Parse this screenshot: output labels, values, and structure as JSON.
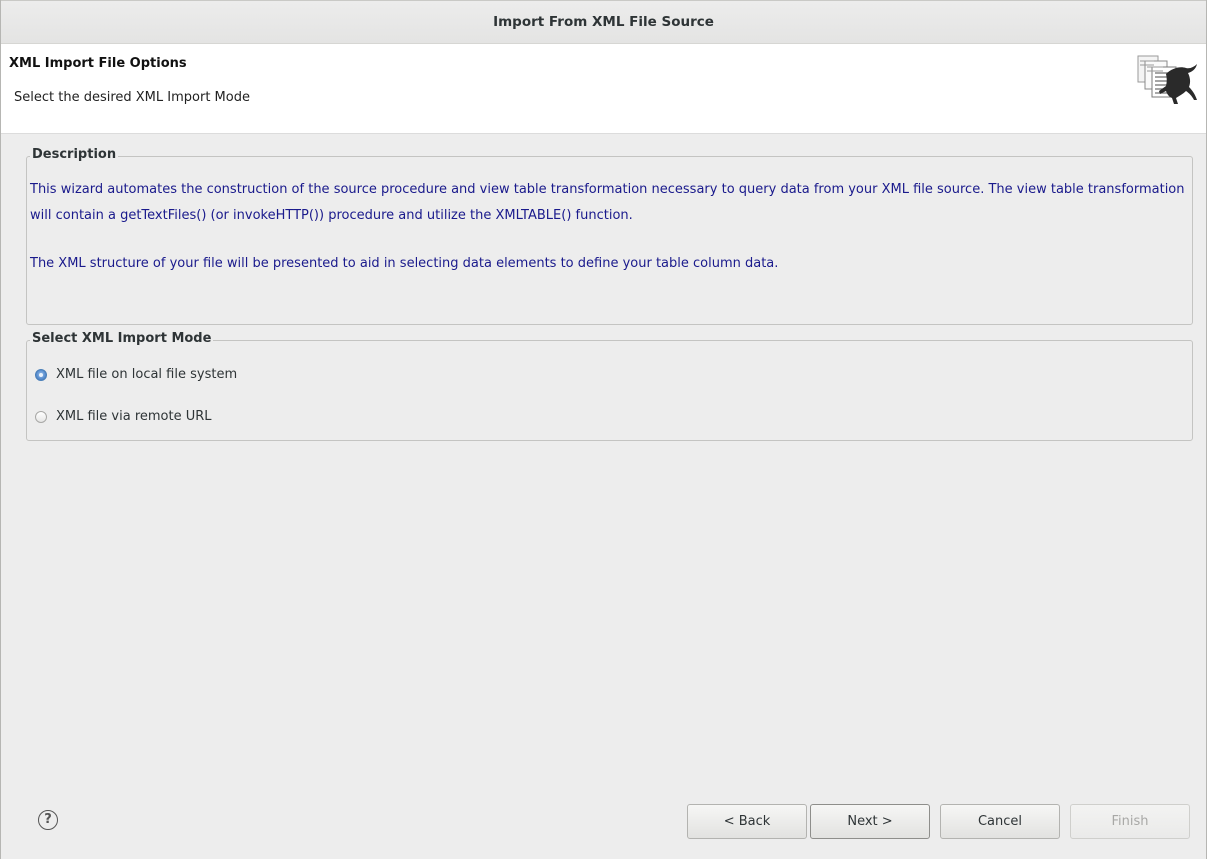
{
  "window": {
    "title": "Import From XML File Source"
  },
  "banner": {
    "title": "XML Import File Options",
    "subtitle": "Select the desired XML Import Mode",
    "icon": "documents-lizard-icon"
  },
  "description": {
    "legend": "Description",
    "paragraph1": "This wizard automates the construction of the source procedure and view table transformation necessary to query data from your XML file source. The view table transformation will contain a getTextFiles() (or invokeHTTP()) procedure and utilize the XMLTABLE() function.",
    "paragraph2": "The XML structure of your file will be presented to aid in selecting data elements to define your table column data.",
    "text_color": "#1a1a8c"
  },
  "import_mode": {
    "legend": "Select XML Import Mode",
    "options": [
      {
        "label": "XML file on local file system",
        "checked": true
      },
      {
        "label": "XML file via remote URL",
        "checked": false
      }
    ]
  },
  "footer": {
    "help_icon": "help-icon",
    "help_glyph": "?",
    "back_label": "< Back",
    "next_label": "Next >",
    "cancel_label": "Cancel",
    "finish_label": "Finish",
    "finish_enabled": false
  }
}
